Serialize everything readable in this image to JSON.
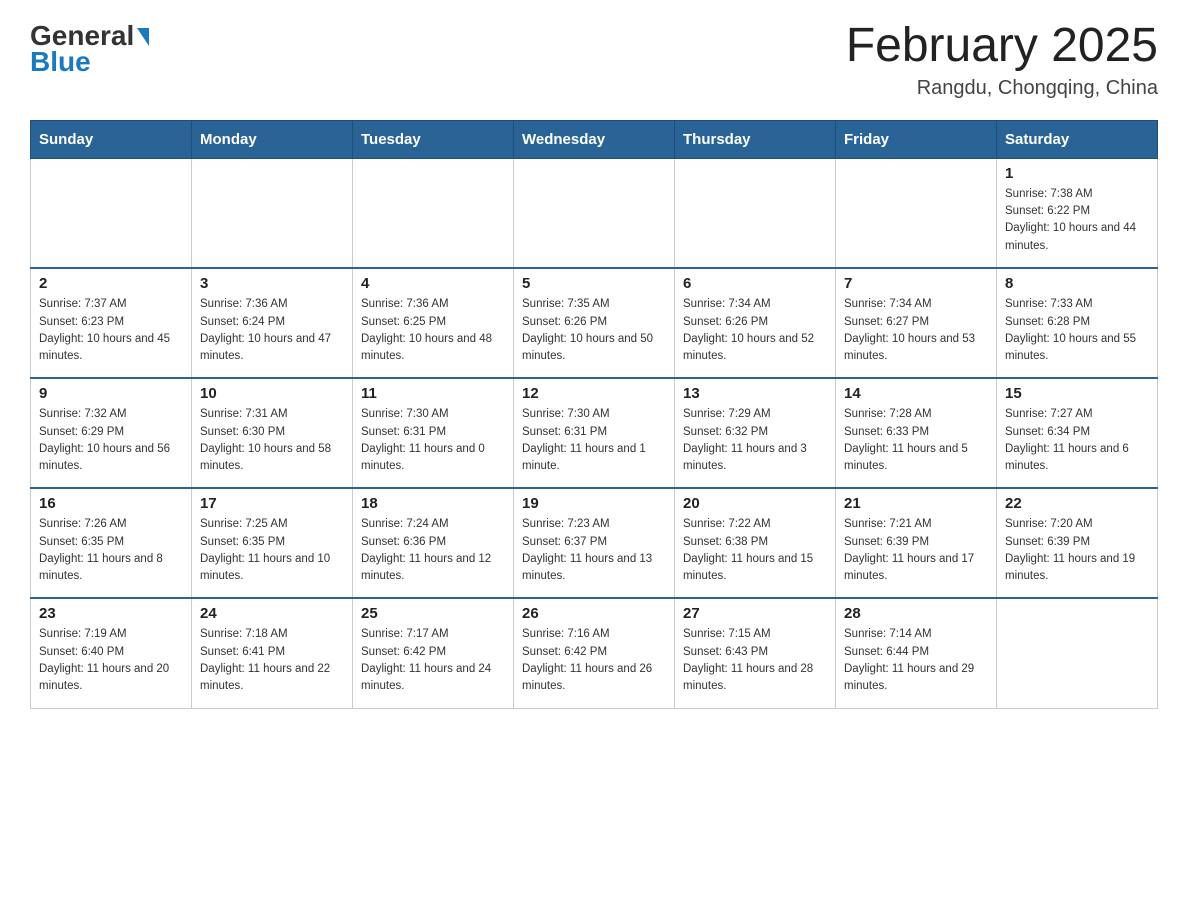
{
  "header": {
    "logo_general": "General",
    "logo_blue": "Blue",
    "title": "February 2025",
    "subtitle": "Rangdu, Chongqing, China"
  },
  "weekdays": [
    "Sunday",
    "Monday",
    "Tuesday",
    "Wednesday",
    "Thursday",
    "Friday",
    "Saturday"
  ],
  "weeks": [
    [
      {
        "day": "",
        "info": ""
      },
      {
        "day": "",
        "info": ""
      },
      {
        "day": "",
        "info": ""
      },
      {
        "day": "",
        "info": ""
      },
      {
        "day": "",
        "info": ""
      },
      {
        "day": "",
        "info": ""
      },
      {
        "day": "1",
        "info": "Sunrise: 7:38 AM\nSunset: 6:22 PM\nDaylight: 10 hours and 44 minutes."
      }
    ],
    [
      {
        "day": "2",
        "info": "Sunrise: 7:37 AM\nSunset: 6:23 PM\nDaylight: 10 hours and 45 minutes."
      },
      {
        "day": "3",
        "info": "Sunrise: 7:36 AM\nSunset: 6:24 PM\nDaylight: 10 hours and 47 minutes."
      },
      {
        "day": "4",
        "info": "Sunrise: 7:36 AM\nSunset: 6:25 PM\nDaylight: 10 hours and 48 minutes."
      },
      {
        "day": "5",
        "info": "Sunrise: 7:35 AM\nSunset: 6:26 PM\nDaylight: 10 hours and 50 minutes."
      },
      {
        "day": "6",
        "info": "Sunrise: 7:34 AM\nSunset: 6:26 PM\nDaylight: 10 hours and 52 minutes."
      },
      {
        "day": "7",
        "info": "Sunrise: 7:34 AM\nSunset: 6:27 PM\nDaylight: 10 hours and 53 minutes."
      },
      {
        "day": "8",
        "info": "Sunrise: 7:33 AM\nSunset: 6:28 PM\nDaylight: 10 hours and 55 minutes."
      }
    ],
    [
      {
        "day": "9",
        "info": "Sunrise: 7:32 AM\nSunset: 6:29 PM\nDaylight: 10 hours and 56 minutes."
      },
      {
        "day": "10",
        "info": "Sunrise: 7:31 AM\nSunset: 6:30 PM\nDaylight: 10 hours and 58 minutes."
      },
      {
        "day": "11",
        "info": "Sunrise: 7:30 AM\nSunset: 6:31 PM\nDaylight: 11 hours and 0 minutes."
      },
      {
        "day": "12",
        "info": "Sunrise: 7:30 AM\nSunset: 6:31 PM\nDaylight: 11 hours and 1 minute."
      },
      {
        "day": "13",
        "info": "Sunrise: 7:29 AM\nSunset: 6:32 PM\nDaylight: 11 hours and 3 minutes."
      },
      {
        "day": "14",
        "info": "Sunrise: 7:28 AM\nSunset: 6:33 PM\nDaylight: 11 hours and 5 minutes."
      },
      {
        "day": "15",
        "info": "Sunrise: 7:27 AM\nSunset: 6:34 PM\nDaylight: 11 hours and 6 minutes."
      }
    ],
    [
      {
        "day": "16",
        "info": "Sunrise: 7:26 AM\nSunset: 6:35 PM\nDaylight: 11 hours and 8 minutes."
      },
      {
        "day": "17",
        "info": "Sunrise: 7:25 AM\nSunset: 6:35 PM\nDaylight: 11 hours and 10 minutes."
      },
      {
        "day": "18",
        "info": "Sunrise: 7:24 AM\nSunset: 6:36 PM\nDaylight: 11 hours and 12 minutes."
      },
      {
        "day": "19",
        "info": "Sunrise: 7:23 AM\nSunset: 6:37 PM\nDaylight: 11 hours and 13 minutes."
      },
      {
        "day": "20",
        "info": "Sunrise: 7:22 AM\nSunset: 6:38 PM\nDaylight: 11 hours and 15 minutes."
      },
      {
        "day": "21",
        "info": "Sunrise: 7:21 AM\nSunset: 6:39 PM\nDaylight: 11 hours and 17 minutes."
      },
      {
        "day": "22",
        "info": "Sunrise: 7:20 AM\nSunset: 6:39 PM\nDaylight: 11 hours and 19 minutes."
      }
    ],
    [
      {
        "day": "23",
        "info": "Sunrise: 7:19 AM\nSunset: 6:40 PM\nDaylight: 11 hours and 20 minutes."
      },
      {
        "day": "24",
        "info": "Sunrise: 7:18 AM\nSunset: 6:41 PM\nDaylight: 11 hours and 22 minutes."
      },
      {
        "day": "25",
        "info": "Sunrise: 7:17 AM\nSunset: 6:42 PM\nDaylight: 11 hours and 24 minutes."
      },
      {
        "day": "26",
        "info": "Sunrise: 7:16 AM\nSunset: 6:42 PM\nDaylight: 11 hours and 26 minutes."
      },
      {
        "day": "27",
        "info": "Sunrise: 7:15 AM\nSunset: 6:43 PM\nDaylight: 11 hours and 28 minutes."
      },
      {
        "day": "28",
        "info": "Sunrise: 7:14 AM\nSunset: 6:44 PM\nDaylight: 11 hours and 29 minutes."
      },
      {
        "day": "",
        "info": ""
      }
    ]
  ]
}
